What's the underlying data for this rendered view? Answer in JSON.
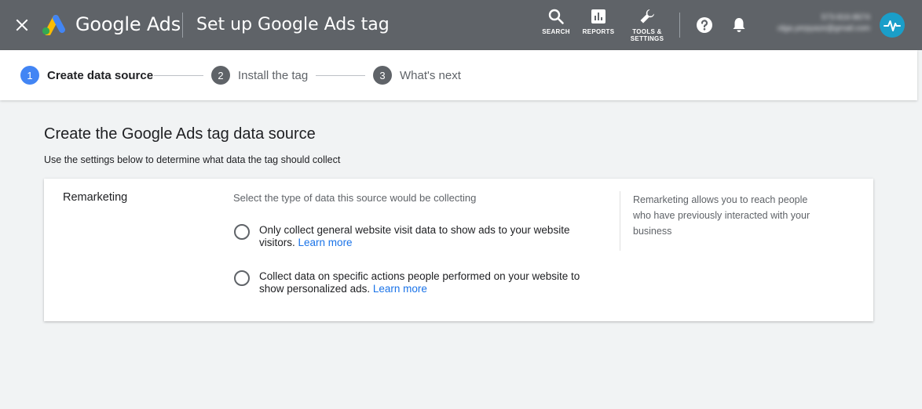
{
  "appbar": {
    "brand": "Google Ads",
    "title": "Set up Google Ads tag",
    "close_icon": "close-icon",
    "tools": {
      "search_label": "SEARCH",
      "reports_label": "REPORTS",
      "settings_label_line1": "TOOLS &",
      "settings_label_line2": "SETTINGS"
    },
    "account": {
      "id": "573-816-8674",
      "email": "olga.yerpyaze@gmail.com"
    },
    "colors": {
      "bar": "#5f6368",
      "avatar": "#1a9ec9"
    }
  },
  "stepper": {
    "steps": [
      {
        "number": "1",
        "label": "Create data source",
        "state": "active"
      },
      {
        "number": "2",
        "label": "Install the tag",
        "state": "inactive"
      },
      {
        "number": "3",
        "label": "What's next",
        "state": "inactive"
      }
    ],
    "colors": {
      "active": "#4285f4",
      "inactive": "#5f6368"
    }
  },
  "main": {
    "title": "Create the Google Ads tag data source",
    "subtitle": "Use the settings below to determine what data the tag should collect",
    "card": {
      "label": "Remarketing",
      "question": "Select the type of data this source would be collecting",
      "options": [
        {
          "text": "Only collect general website visit data to show ads to your website visitors.",
          "link": "Learn more",
          "selected": false
        },
        {
          "text": "Collect data on specific actions people performed on your website to show personalized ads.",
          "link": "Learn more",
          "selected": false
        }
      ],
      "help": "Remarketing allows you to reach people who have previously interacted with your business"
    }
  }
}
